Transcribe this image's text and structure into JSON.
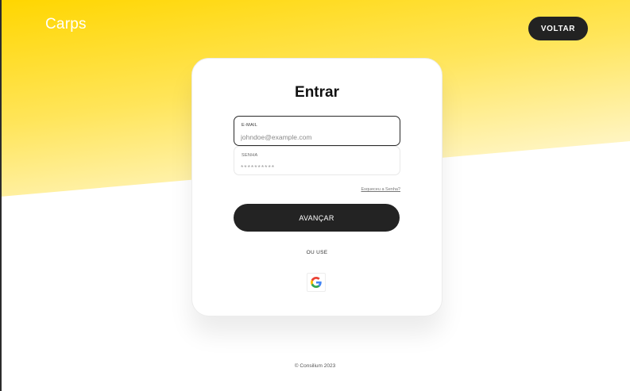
{
  "brand": {
    "name": "Carps"
  },
  "header": {
    "back_label": "VOLTAR"
  },
  "login": {
    "title": "Entrar",
    "email": {
      "label": "E-MAIL",
      "placeholder": "johndoe@example.com"
    },
    "password": {
      "label": "SENHA",
      "placeholder": "**********"
    },
    "forgot_label": "Esqueceu a Senha?",
    "submit_label": "AVANÇAR",
    "alt_text": "OU USE",
    "google_icon": "google-icon"
  },
  "footer": {
    "text": "© Consilium 2023"
  },
  "colors": {
    "brand_yellow": "#ffd600",
    "dark": "#222222",
    "white": "#ffffff"
  }
}
